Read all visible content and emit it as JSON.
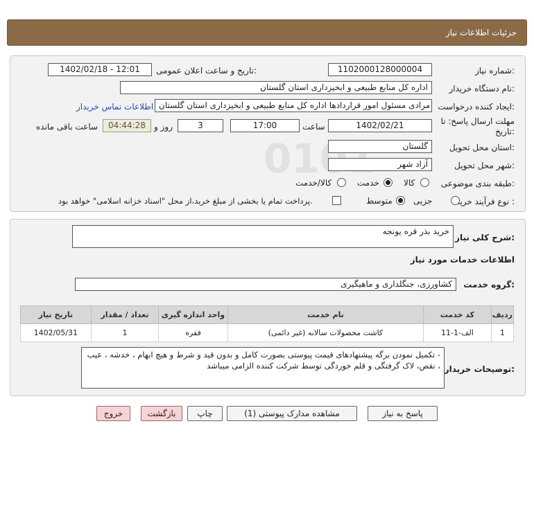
{
  "title": "جزئیات اطلاعات نیاز",
  "labels": {
    "need_number": "شماره نیاز:",
    "announce_datetime": "تاریخ و ساعت اعلان عمومی:",
    "buyer_org": "نام دستگاه خریدار:",
    "requester": "ایجاد کننده درخواست:",
    "deadline": "مهلت ارسال پاسخ: تا تاریخ:",
    "time": "ساعت",
    "days_and": "روز و",
    "remaining": "ساعت باقی مانده",
    "province": "استان محل تحویل:",
    "city": "شهر محل تحویل:",
    "category": "طبقه بندی موضوعی:",
    "process": "نوع فرآیند خرید :",
    "description": "شرح کلی نیاز:",
    "services_info": "اطلاعات خدمات مورد نیاز",
    "service_group": "گروه خدمت:",
    "buyer_notes": "توضیحات خریدار:"
  },
  "values": {
    "need_number": "1102000128000004",
    "announce_datetime": "1402/02/18 - 12:01",
    "buyer_org": "اداره کل منابع طبیعی و ابخیزداری استان گلستان",
    "requester": "ولی اله مرادی مسئول امور قراردادها اداره کل منابع طبیعی و ابخیزداری استان گلستان",
    "contact_link": "اطلاعات تماس خریدار",
    "deadline_date": "1402/02/21",
    "deadline_time": "17:00",
    "days": "3",
    "remaining_time": "04:44:28",
    "province": "گلستان",
    "city": "آزاد شهر",
    "description": "خرید بذر قره یونجه",
    "service_group": "کشاورزی، جنگلداری و ماهیگیری",
    "buyer_notes": "- تکمیل نمودن برگه پیشنهادهای قیمت پیوستی بصورت کامل و بدون قید و شرط و هیچ ابهام ، خدشه ، عیب ، نقص، لاک گرفتگی و قلم خوردگی توسط شرکت کننده الزامی میباشد"
  },
  "category_options": [
    {
      "label": "کالا",
      "selected": false
    },
    {
      "label": "خدمت",
      "selected": true
    },
    {
      "label": "کالا/خدمت",
      "selected": false
    }
  ],
  "process_options": [
    {
      "label": "جزیی",
      "selected": false
    },
    {
      "label": "متوسط",
      "selected": true
    }
  ],
  "payment_note": "پرداخت تمام یا بخشی از مبلغ خرید،از محل \"اسناد خزانه اسلامی\" خواهد بود.",
  "payment_checked": false,
  "table": {
    "headers": [
      "ردیف",
      "کد خدمت",
      "نام خدمت",
      "واحد اندازه گیری",
      "تعداد / مقدار",
      "تاریخ نیاز"
    ],
    "rows": [
      [
        "1",
        "الف-1-11",
        "کاشت محصولات سالانه (غیر دائمی)",
        "فقره",
        "1",
        "1402/05/31"
      ]
    ]
  },
  "buttons": {
    "reply": "پاسخ به نیاز",
    "view_docs": "مشاهده مدارک پیوستی (1)",
    "print": "چاپ",
    "back": "بازگشت",
    "exit": "خروج"
  },
  "colors": {
    "header_bg": "#8b6a48",
    "link": "#1f4aa8",
    "exit_bg": "#f8d3d6"
  }
}
